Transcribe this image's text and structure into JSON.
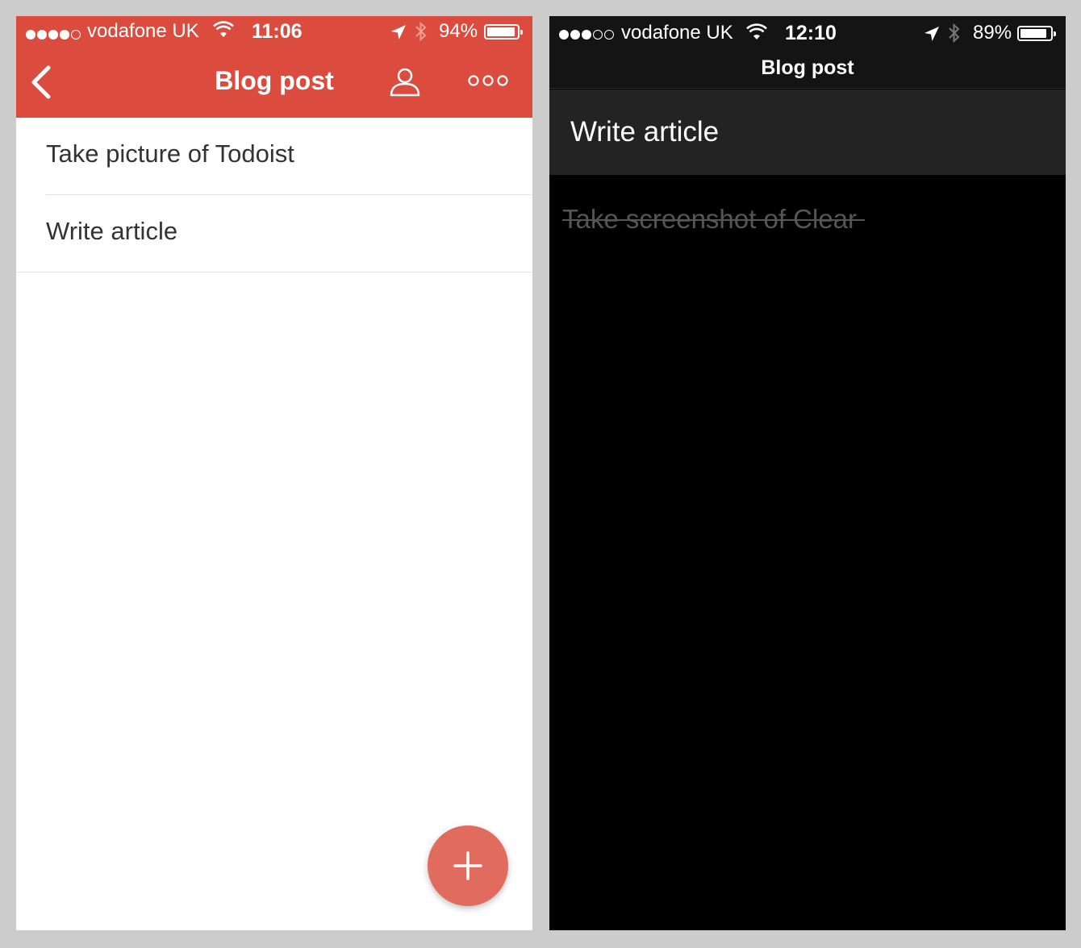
{
  "left_app": {
    "status_bar": {
      "carrier": "vodafone UK",
      "time": "11:06",
      "battery_percent": "94%",
      "battery_level": 0.94,
      "signal_bars_filled": 4,
      "signal_bars_total": 5
    },
    "header": {
      "title": "Blog post",
      "background_color": "#db4c3f"
    },
    "tasks": [
      {
        "label": "Take picture of Todoist"
      },
      {
        "label": "Write article"
      }
    ],
    "fab": {
      "icon": "plus-icon",
      "color": "#e16c5e"
    }
  },
  "right_app": {
    "status_bar": {
      "carrier": "vodafone UK",
      "time": "12:10",
      "battery_percent": "89%",
      "battery_level": 0.89,
      "signal_bars_filled": 3,
      "signal_bars_total": 5
    },
    "header": {
      "title": "Blog post"
    },
    "active_task": {
      "label": "Write article"
    },
    "completed_task": {
      "label": "Take screenshot of Clear"
    }
  }
}
